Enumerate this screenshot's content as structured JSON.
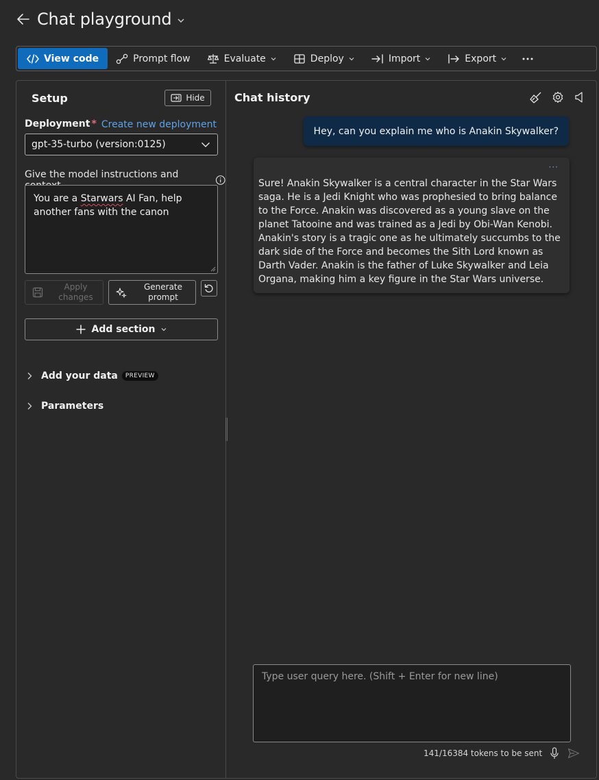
{
  "header": {
    "title": "Chat playground"
  },
  "toolbar": {
    "view_code": "View code",
    "prompt_flow": "Prompt flow",
    "evaluate": "Evaluate",
    "deploy": "Deploy",
    "import": "Import",
    "export": "Export",
    "more": "···"
  },
  "setup": {
    "title": "Setup",
    "hide": "Hide",
    "deployment_label": "Deployment",
    "required_mark": "*",
    "create_link": "Create new deployment",
    "deployment_value": "gpt-35-turbo (version:0125)",
    "instructions_label": "Give the model instructions and context",
    "instructions_before": "You are a ",
    "instructions_misspelled": "Starwars",
    "instructions_after": " AI Fan, help another fans with the canon",
    "apply_changes": "Apply changes",
    "generate_prompt": "Generate prompt",
    "add_section": "Add section",
    "add_your_data": "Add your data",
    "preview_badge": "PREVIEW",
    "parameters": "Parameters"
  },
  "chat": {
    "title": "Chat history",
    "user_message": "Hey, can you explain me who is Anakin Skywalker?",
    "bot_more": "···",
    "bot_message": "Sure! Anakin Skywalker is a central character in the Star Wars saga. He is a Jedi Knight who was prophesied to bring balance to the Force. Anakin was discovered as a young slave on the planet Tatooine and was trained as a Jedi by Obi-Wan Kenobi. Anakin's story is a tragic one as he ultimately succumbs to the dark side of the Force and becomes the Sith Lord known as Darth Vader. Anakin is the father of Luke Skywalker and Leia Organa, making him a key figure in the Star Wars universe.",
    "query_placeholder": "Type user query here. (Shift + Enter for new line)",
    "token_count": "141/16384 tokens to be sent"
  },
  "colors": {
    "primary": "#0f6cbd",
    "link": "#5ba3e6",
    "user_bubble": "#0e2a47",
    "background": "#292929",
    "required": "#e06c75"
  },
  "icons": {
    "back": "arrow-left-icon",
    "code": "code-icon",
    "flow": "flow-icon",
    "evaluate": "scale-icon",
    "deploy": "cube-icon",
    "import": "import-icon",
    "export": "export-icon",
    "clear": "broom-icon",
    "settings": "gear-icon",
    "speaker": "speaker-icon",
    "mic": "microphone-icon",
    "send": "send-icon"
  }
}
